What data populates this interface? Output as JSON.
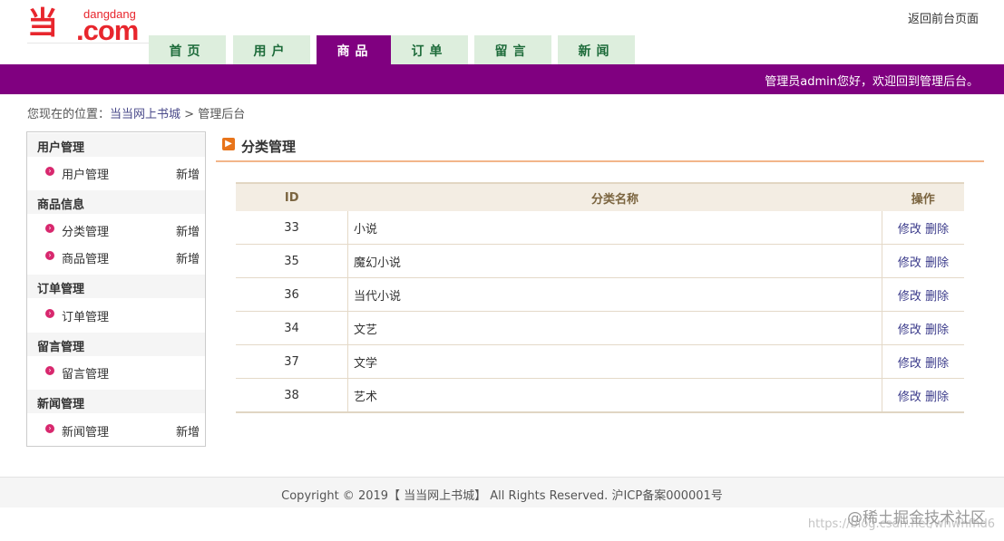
{
  "header": {
    "logo_small": "dangdang",
    "logo_com": ".com",
    "back_link": "返回前台页面",
    "welcome": "管理员admin您好，欢迎回到管理后台。"
  },
  "nav": {
    "tabs": [
      {
        "label": "首页"
      },
      {
        "label": "用户"
      },
      {
        "label": "商品",
        "active": true
      },
      {
        "label": "订单"
      },
      {
        "label": "留言"
      },
      {
        "label": "新闻"
      }
    ]
  },
  "breadcrumb": {
    "prefix": "您现在的位置：",
    "link": "当当网上书城",
    "sep": ">",
    "current": "管理后台"
  },
  "sidebar": {
    "groups": [
      {
        "title": "用户管理",
        "items": [
          {
            "label": "用户管理",
            "add": "新增"
          }
        ]
      },
      {
        "title": "商品信息",
        "items": [
          {
            "label": "分类管理",
            "add": "新增"
          },
          {
            "label": "商品管理",
            "add": "新增"
          }
        ]
      },
      {
        "title": "订单管理",
        "items": [
          {
            "label": "订单管理",
            "add": ""
          }
        ]
      },
      {
        "title": "留言管理",
        "items": [
          {
            "label": "留言管理",
            "add": ""
          }
        ]
      },
      {
        "title": "新闻管理",
        "items": [
          {
            "label": "新闻管理",
            "add": "新增"
          }
        ]
      }
    ]
  },
  "main": {
    "title": "分类管理",
    "columns": {
      "id": "ID",
      "name": "分类名称",
      "op": "操作"
    },
    "rows": [
      {
        "id": "33",
        "name": "小说",
        "child": false
      },
      {
        "id": "35",
        "name": "魔幻小说",
        "child": true
      },
      {
        "id": "36",
        "name": "当代小说",
        "child": true
      },
      {
        "id": "34",
        "name": "文艺",
        "child": false
      },
      {
        "id": "37",
        "name": "文学",
        "child": true
      },
      {
        "id": "38",
        "name": "艺术",
        "child": true
      }
    ],
    "edit_label": "修改",
    "delete_label": "删除"
  },
  "footer": {
    "text": "Copyright © 2019【 当当网上书城】 All Rights Reserved. 沪ICP备案000001号"
  },
  "watermark": {
    "cn": "@稀土掘金技术社区",
    "url": "https://blog.csdn.net/whwhfhd6"
  },
  "colors": {
    "brand_red": "#e8262d",
    "accent_purple": "#800080",
    "tab_green_bg": "#ddeedd",
    "tab_green_text": "#1d6b3a"
  }
}
